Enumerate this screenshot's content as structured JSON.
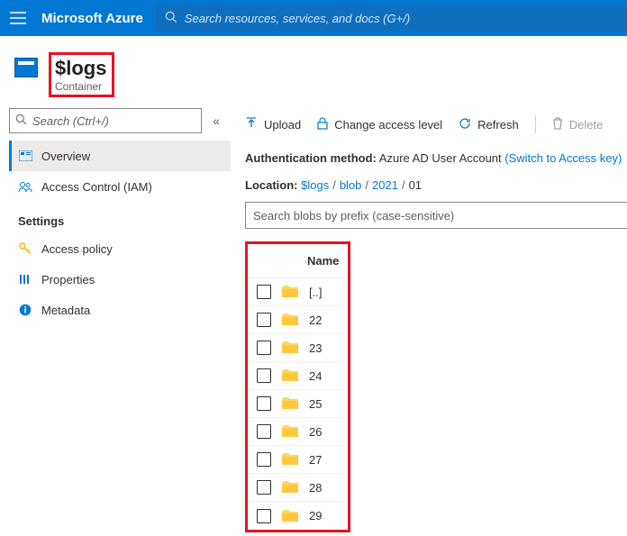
{
  "header": {
    "brand": "Microsoft Azure",
    "search_placeholder": "Search resources, services, and docs (G+/)"
  },
  "page": {
    "title": "$logs",
    "subtitle": "Container"
  },
  "sidebar": {
    "search_placeholder": "Search (Ctrl+/)",
    "items": [
      {
        "label": "Overview"
      },
      {
        "label": "Access Control (IAM)"
      }
    ],
    "group_label": "Settings",
    "settings_items": [
      {
        "label": "Access policy"
      },
      {
        "label": "Properties"
      },
      {
        "label": "Metadata"
      }
    ]
  },
  "toolbar": {
    "upload": "Upload",
    "change_access": "Change access level",
    "refresh": "Refresh",
    "delete": "Delete"
  },
  "meta": {
    "auth_label": "Authentication method:",
    "auth_value": "Azure AD User Account",
    "auth_switch": "(Switch to Access key)",
    "location_label": "Location:",
    "crumbs": [
      "$logs",
      "blob",
      "2021",
      "01"
    ]
  },
  "blob_search_placeholder": "Search blobs by prefix (case-sensitive)",
  "table": {
    "col_name": "Name",
    "rows": [
      {
        "name": "[..]"
      },
      {
        "name": "22"
      },
      {
        "name": "23"
      },
      {
        "name": "24"
      },
      {
        "name": "25"
      },
      {
        "name": "26"
      },
      {
        "name": "27"
      },
      {
        "name": "28"
      },
      {
        "name": "29"
      }
    ]
  }
}
